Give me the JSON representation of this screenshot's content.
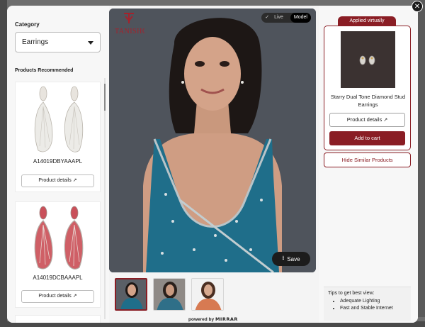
{
  "left_panel": {
    "category_label": "Category",
    "category_value": "Earrings",
    "products_label": "Products Recommended",
    "products": [
      {
        "code": "A14019DBYAAAPL",
        "button": "Product details",
        "color": "#d9d6d1"
      },
      {
        "code": "A14019DCBAAAPL",
        "button": "Product details",
        "color": "#c95a60"
      }
    ]
  },
  "stage": {
    "logo_text": "TANISHQ",
    "toggle": {
      "live": "Live",
      "model": "Model"
    },
    "save_label": "Save",
    "powered_by": "powered by",
    "brand": "MIRRAR"
  },
  "right_panel": {
    "applied_label": "Applied virtually",
    "product_name": "Starry Dual Tone Diamond Stud Earrings",
    "details_button": "Product details",
    "cart_button": "Add to cart",
    "hide_button": "Hide Similar Products",
    "tips_title": "Tips to get best view:",
    "tips": [
      "Adequate Lighting",
      "Fast and Stable Internet"
    ]
  },
  "colors": {
    "accent": "#8a1d24",
    "dress": "#1f6e8a"
  }
}
